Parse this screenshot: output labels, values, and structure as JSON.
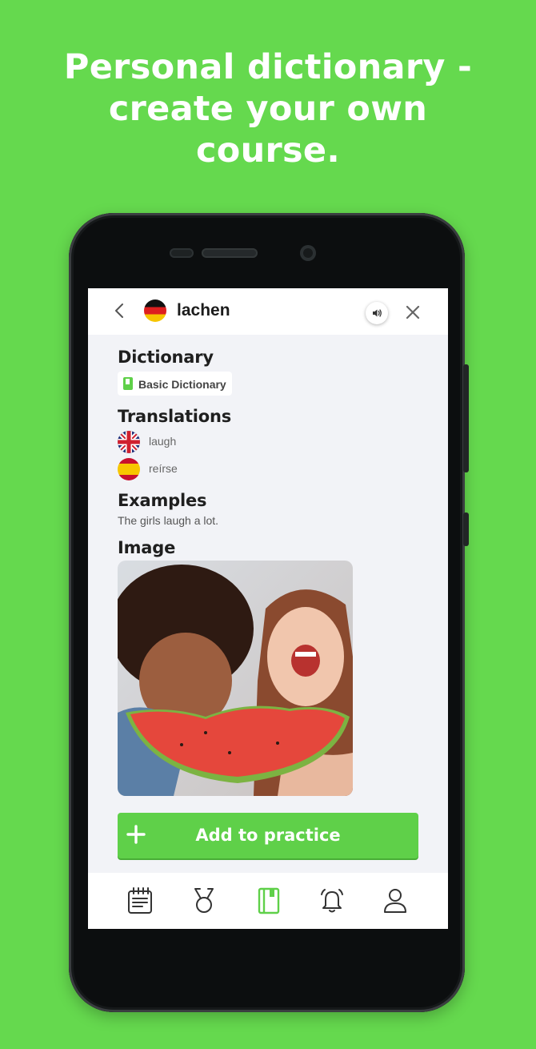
{
  "headline": {
    "line1": "Personal dictionary -",
    "line2": "create your own",
    "line3": "course."
  },
  "colors": {
    "background": "#65d94e",
    "accent": "#5fd049",
    "text_dark": "#1f1f1f"
  },
  "header": {
    "word": "lachen",
    "back_icon": "chevron-left-icon",
    "flag": "german-flag",
    "speaker_icon": "speaker-icon",
    "close_icon": "close-icon"
  },
  "dictionary": {
    "title": "Dictionary",
    "chip_label": "Basic Dictionary"
  },
  "translations": {
    "title": "Translations",
    "items": [
      {
        "flag": "uk-flag",
        "text": "laugh"
      },
      {
        "flag": "spain-flag",
        "text": "reírse"
      }
    ]
  },
  "examples": {
    "title": "Examples",
    "text": "The girls laugh a lot."
  },
  "image": {
    "title": "Image"
  },
  "add_button": {
    "label": "Add to practice"
  },
  "tabbar": {
    "items": [
      {
        "icon": "calendar-icon",
        "active": false
      },
      {
        "icon": "medal-icon",
        "active": false
      },
      {
        "icon": "dictionary-icon",
        "active": true
      },
      {
        "icon": "bell-icon",
        "active": false
      },
      {
        "icon": "profile-icon",
        "active": false
      }
    ]
  }
}
